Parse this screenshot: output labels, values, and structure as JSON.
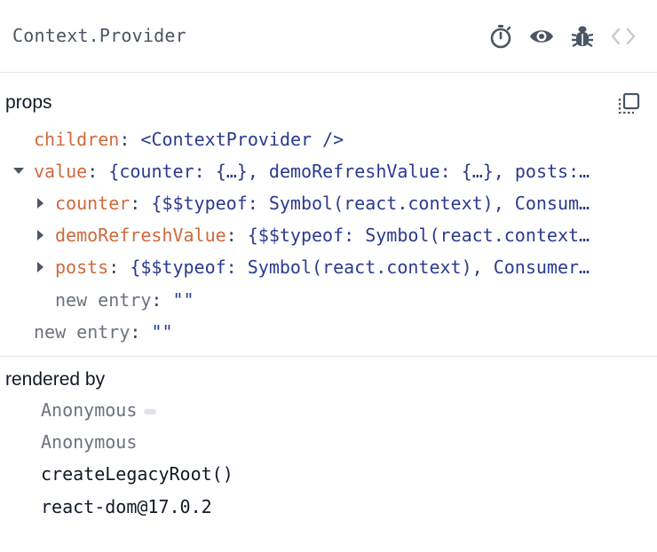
{
  "header": {
    "component_name": "Context.Provider",
    "icons": [
      "stopwatch-icon",
      "eye-icon",
      "bug-icon",
      "code-brackets-icon"
    ]
  },
  "props": {
    "label": "props",
    "rows": [
      {
        "key": "children",
        "sep": ":",
        "value": "<ContextProvider />"
      },
      {
        "key": "value",
        "sep": ":",
        "value": "{counter: {…}, demoRefreshValue: {…}, posts:…"
      },
      {
        "key": "counter",
        "sep": ":",
        "value": "{$$typeof: Symbol(react.context), Consum…"
      },
      {
        "key": "demoRefreshValue",
        "sep": ":",
        "value": "{$$typeof: Symbol(react.context…"
      },
      {
        "key": "posts",
        "sep": ":",
        "value": "{$$typeof: Symbol(react.context), Consumer…"
      },
      {
        "key": "new entry",
        "sep": ":",
        "value": "\"\""
      },
      {
        "key": "new entry",
        "sep": ":",
        "value": "\"\""
      }
    ]
  },
  "rendered_by": {
    "label": "rendered by",
    "owners": [
      "Anonymous",
      "Anonymous",
      "createLegacyRoot()",
      "react-dom@17.0.2"
    ]
  },
  "colors": {
    "prop_key": "#d0693b",
    "prop_value": "#2a3b8f",
    "muted": "#6b7280",
    "icon": "#4b5563",
    "icon_disabled": "#c4c9d2"
  }
}
